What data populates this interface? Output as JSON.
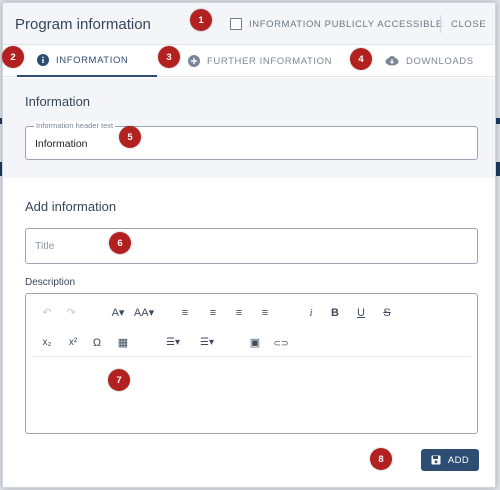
{
  "header": {
    "title": "Program information",
    "public_checkbox_label": "INFORMATION PUBLICLY ACCESSIBLE",
    "public_checked": false,
    "close_label": "CLOSE"
  },
  "tabs": [
    {
      "label": "INFORMATION",
      "icon": "info-icon",
      "active": true
    },
    {
      "label": "FURTHER INFORMATION",
      "icon": "plus-circle-icon",
      "active": false
    },
    {
      "label": "DOWNLOADS",
      "icon": "cloud-download-icon",
      "active": false
    }
  ],
  "info_section": {
    "heading": "Information",
    "field_legend": "Information header text",
    "field_value": "Information"
  },
  "add_section": {
    "heading": "Add information",
    "title_placeholder": "Title",
    "description_label": "Description"
  },
  "editor_toolbar": {
    "row1": [
      {
        "icon": "undo-icon",
        "glyph": "↶",
        "enabled": false
      },
      {
        "icon": "redo-icon",
        "glyph": "↷",
        "enabled": false
      },
      {
        "icon": "font-family-icon",
        "glyph": "A▾",
        "enabled": true
      },
      {
        "icon": "font-size-icon",
        "glyph": "AA▾",
        "enabled": true
      },
      {
        "icon": "align-left-icon",
        "glyph": "≡",
        "enabled": true
      },
      {
        "icon": "align-center-icon",
        "glyph": "≡",
        "enabled": true
      },
      {
        "icon": "align-justify-icon",
        "glyph": "≡",
        "enabled": true
      },
      {
        "icon": "align-right-icon",
        "glyph": "≡",
        "enabled": true
      },
      {
        "icon": "italic-icon",
        "glyph": "i",
        "enabled": true
      },
      {
        "icon": "bold-icon",
        "glyph": "B",
        "enabled": true
      },
      {
        "icon": "underline-icon",
        "glyph": "U",
        "enabled": true
      },
      {
        "icon": "strikethrough-icon",
        "glyph": "S",
        "enabled": true
      }
    ],
    "row2": [
      {
        "icon": "subscript-icon",
        "glyph": "x₂",
        "enabled": true
      },
      {
        "icon": "superscript-icon",
        "glyph": "x²",
        "enabled": true
      },
      {
        "icon": "special-char-icon",
        "glyph": "Ω",
        "enabled": true
      },
      {
        "icon": "table-icon",
        "glyph": "▦",
        "enabled": true
      },
      {
        "icon": "bullet-list-icon",
        "glyph": "☰▾",
        "enabled": true
      },
      {
        "icon": "numbered-list-icon",
        "glyph": "☰▾",
        "enabled": true
      },
      {
        "icon": "image-icon",
        "glyph": "▣",
        "enabled": true
      },
      {
        "icon": "link-icon",
        "glyph": "⊂⊃",
        "enabled": true
      }
    ]
  },
  "add_button": {
    "label": "ADD",
    "icon": "save-icon"
  },
  "annotations": [
    "1",
    "2",
    "3",
    "4",
    "5",
    "6",
    "7",
    "8"
  ],
  "colors": {
    "primary": "#2e4d73",
    "badge": "#b22020",
    "backdrop": "#1e3a5f"
  }
}
